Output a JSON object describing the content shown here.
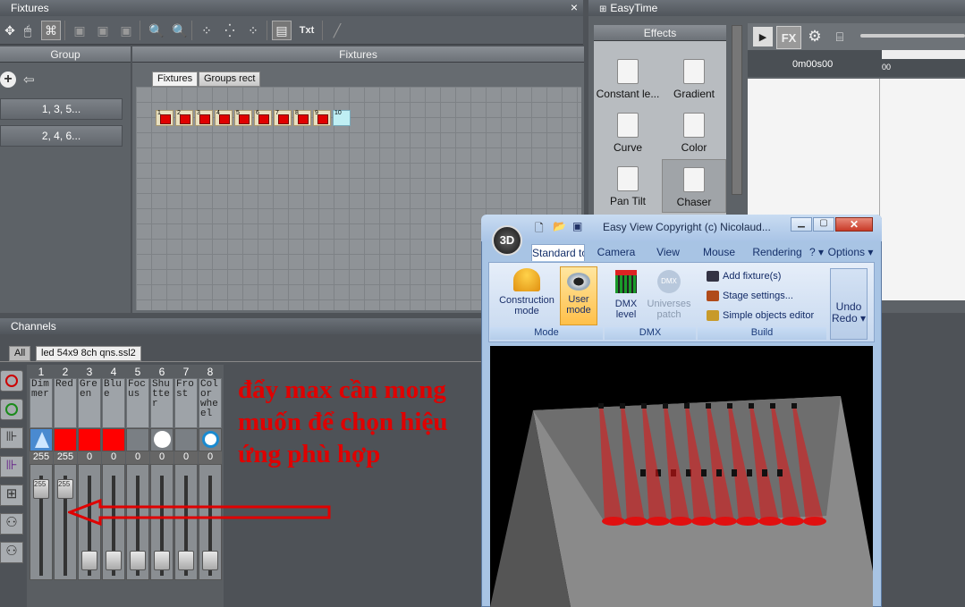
{
  "fixtures_window": {
    "title": "Fixtures",
    "close": "×",
    "toolbar_text_label": "Txt",
    "group_panel_title": "Group",
    "groups": [
      "1, 3, 5...",
      "2, 4, 6..."
    ],
    "fixtures_panel_title": "Fixtures",
    "tabs": [
      "Fixtures",
      "Groups rect"
    ],
    "fixtures": [
      "1",
      "2",
      "3",
      "4",
      "5",
      "6",
      "7",
      "8",
      "9",
      "10"
    ]
  },
  "easytime_window": {
    "title": "EasyTime",
    "effects_title": "Effects",
    "effects": [
      "Constant le...",
      "Gradient",
      "Curve",
      "Color",
      "Pan Tilt",
      "Chaser"
    ],
    "time_label": "0m00s00",
    "ruler_label": "00"
  },
  "channels_window": {
    "title": "Channels",
    "tabs": [
      "All",
      "led 54x9 8ch qns.ssl2"
    ],
    "channels": [
      {
        "num": "1",
        "name": "Dimmer",
        "value": "255",
        "swatch": "#4a8ad0"
      },
      {
        "num": "2",
        "name": "Red",
        "value": "255",
        "swatch": "#ff0000"
      },
      {
        "num": "3",
        "name": "Green",
        "value": "0",
        "swatch": "#ff0000"
      },
      {
        "num": "4",
        "name": "Blue",
        "value": "0",
        "swatch": "#ff0000"
      },
      {
        "num": "5",
        "name": "Focus",
        "value": "0",
        "swatch": "#7a7f84"
      },
      {
        "num": "6",
        "name": "Shutter",
        "value": "0",
        "swatch": "#7a7f84"
      },
      {
        "num": "7",
        "name": "Frost",
        "value": "0",
        "swatch": "#7a7f84"
      },
      {
        "num": "8",
        "name": "Color wheel",
        "value": "0",
        "swatch": "#7a7f84"
      }
    ],
    "knob_labels": [
      "255",
      "255"
    ],
    "annotation": "đẩy max cần mong muốn để chọn hiệu ứng phù hợp"
  },
  "easy_view": {
    "title": "Easy View  Copyright (c) Nicolaud...",
    "logo": "3D",
    "tabs": [
      "Standard to",
      "Camera",
      "View",
      "Mouse",
      "Rendering",
      "?",
      "Options"
    ],
    "mode_group": {
      "label": "Mode",
      "buttons": [
        "Construction mode",
        "User mode"
      ]
    },
    "dmx_group": {
      "label": "DMX",
      "buttons": [
        "DMX level",
        "Universes patch"
      ]
    },
    "build_group": {
      "label": "Build",
      "items": [
        "Add fixture(s)",
        "Stage settings...",
        "Simple objects editor"
      ]
    },
    "undo_redo": "Undo Redo"
  },
  "colors": {
    "accent_red": "#ff0000",
    "annotation_red": "#e00000",
    "ribbon_blue": "#bcd4f0"
  }
}
